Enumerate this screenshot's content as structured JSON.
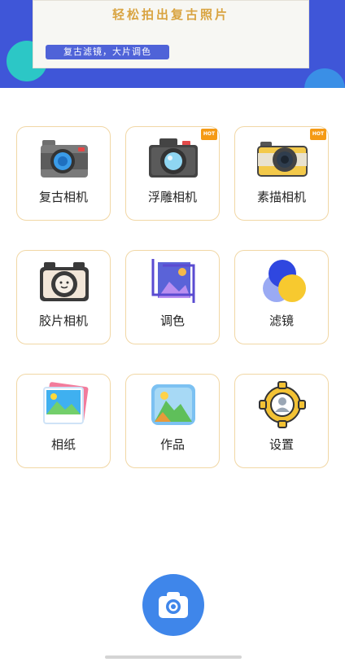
{
  "banner": {
    "headline": "轻松拍出复古照片",
    "subtitle": "复古滤镜，大片调色"
  },
  "tiles": [
    {
      "label": "复古相机",
      "icon": "retro-camera-icon",
      "hot": ""
    },
    {
      "label": "浮雕相机",
      "icon": "emboss-camera-icon",
      "hot": "HOT"
    },
    {
      "label": "素描相机",
      "icon": "sketch-camera-icon",
      "hot": "HOT"
    },
    {
      "label": "胶片相机",
      "icon": "film-camera-icon",
      "hot": ""
    },
    {
      "label": "调色",
      "icon": "crop-color-icon",
      "hot": ""
    },
    {
      "label": "滤镜",
      "icon": "filter-circles-icon",
      "hot": ""
    },
    {
      "label": "相纸",
      "icon": "photo-paper-icon",
      "hot": ""
    },
    {
      "label": "作品",
      "icon": "gallery-icon",
      "hot": ""
    },
    {
      "label": "设置",
      "icon": "settings-gear-icon",
      "hot": ""
    }
  ],
  "colors": {
    "banner_bg": "#3f56d8",
    "tile_border": "#f1d7a5",
    "hot_badge": "#f59a14",
    "fab": "#3f86ea"
  }
}
